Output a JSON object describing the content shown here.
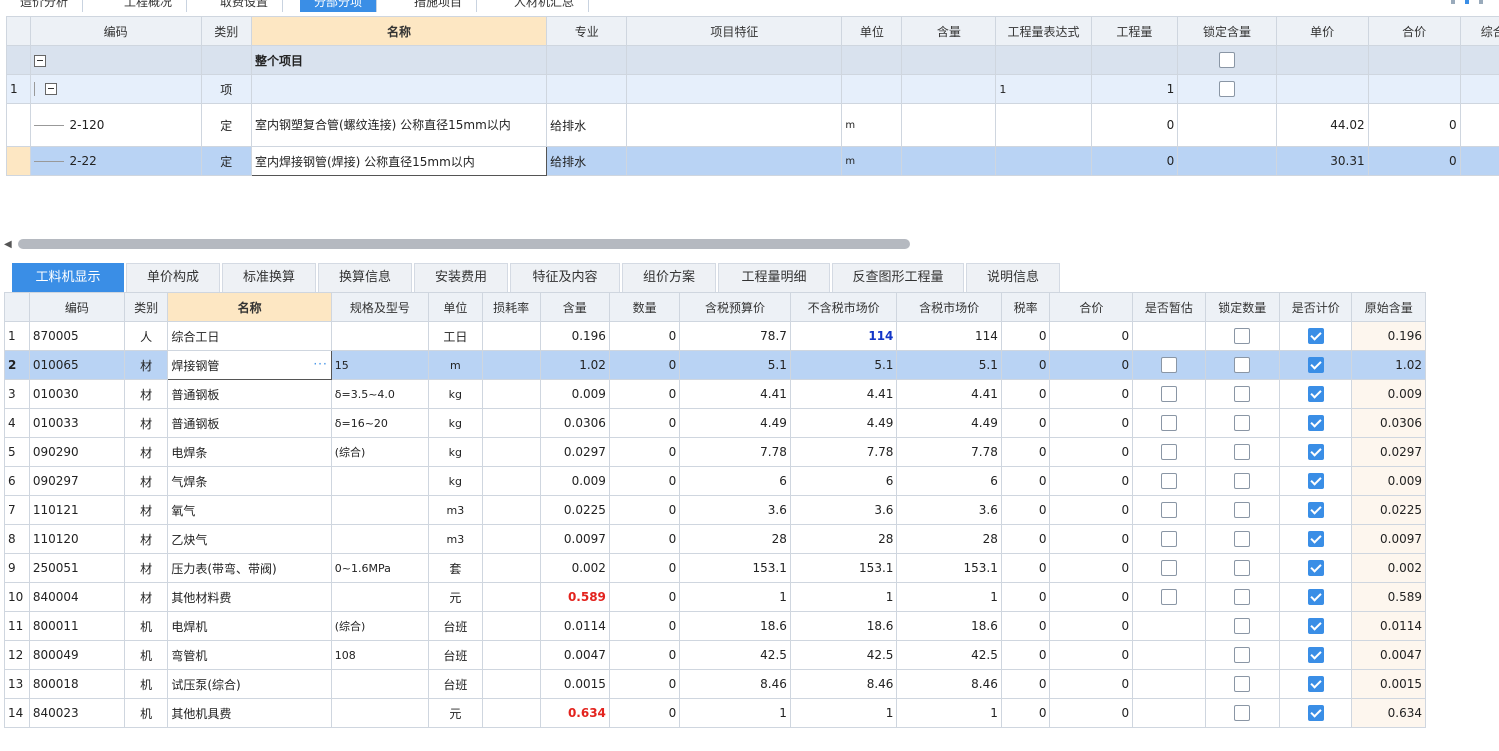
{
  "top_tabs": [
    {
      "label": "造价分析"
    },
    {
      "label": "工程概况"
    },
    {
      "label": "取费设置"
    },
    {
      "label": "分部分项",
      "active": true
    },
    {
      "label": "措施项目"
    },
    {
      "label": "人材机汇总"
    }
  ],
  "upper_table": {
    "headers": [
      "编码",
      "类别",
      "名称",
      "专业",
      "项目特征",
      "单位",
      "含量",
      "工程量表达式",
      "工程量",
      "锁定含量",
      "单价",
      "合价",
      "综合"
    ],
    "rows": [
      {
        "idx": "",
        "code": "",
        "type": "",
        "name": "整个项目",
        "major": "",
        "feature": "",
        "unit": "",
        "content": "",
        "expr": "",
        "qty": "",
        "lock": false,
        "price": "",
        "total": ""
      },
      {
        "idx": "1",
        "code": "",
        "type": "项",
        "name": "",
        "major": "",
        "feature": "",
        "unit": "",
        "content": "",
        "expr": "1",
        "qty": "1",
        "lock": false,
        "price": "",
        "total": ""
      },
      {
        "idx": "",
        "code": "2-120",
        "type": "定",
        "name": "室内钢塑复合管(螺纹连接) 公称直径15mm以内",
        "major": "给排水",
        "feature": "",
        "unit": "m",
        "content": "",
        "expr": "",
        "qty": "0",
        "price": "44.02",
        "total": "0"
      },
      {
        "idx": "",
        "code": "2-22",
        "type": "定",
        "name": "室内焊接钢管(焊接) 公称直径15mm以内",
        "major": "给排水",
        "feature": "",
        "unit": "m",
        "content": "",
        "expr": "",
        "qty": "0",
        "price": "30.31",
        "total": "0"
      }
    ]
  },
  "lower_tabs": [
    {
      "label": "工料机显示",
      "active": true
    },
    {
      "label": "单价构成"
    },
    {
      "label": "标准换算"
    },
    {
      "label": "换算信息"
    },
    {
      "label": "安装费用"
    },
    {
      "label": "特征及内容"
    },
    {
      "label": "组价方案"
    },
    {
      "label": "工程量明细"
    },
    {
      "label": "反查图形工程量"
    },
    {
      "label": "说明信息"
    }
  ],
  "lower_table": {
    "headers": [
      "编码",
      "类别",
      "名称",
      "规格及型号",
      "单位",
      "损耗率",
      "含量",
      "数量",
      "含税预算价",
      "不含税市场价",
      "含税市场价",
      "税率",
      "合价",
      "是否暂估",
      "锁定数量",
      "是否计价",
      "原始含量"
    ],
    "rows": [
      {
        "idx": "1",
        "code": "870005",
        "type": "人",
        "name": "综合工日",
        "spec": "",
        "unit": "工日",
        "loss": "",
        "content": "0.196",
        "qty": "0",
        "budget": "78.7",
        "mkt_ex": "114",
        "mkt_in": "114",
        "tax": "0",
        "total": "0",
        "est": null,
        "lockq": false,
        "priced": true,
        "orig": "0.196"
      },
      {
        "idx": "2",
        "code": "010065",
        "type": "材",
        "name": "焊接钢管",
        "spec": "15",
        "unit": "m",
        "loss": "",
        "content": "1.02",
        "qty": "0",
        "budget": "5.1",
        "mkt_ex": "5.1",
        "mkt_in": "5.1",
        "tax": "0",
        "total": "0",
        "est": false,
        "lockq": false,
        "priced": true,
        "orig": "1.02"
      },
      {
        "idx": "3",
        "code": "010030",
        "type": "材",
        "name": "普通钢板",
        "spec": "δ=3.5~4.0",
        "unit": "kg",
        "loss": "",
        "content": "0.009",
        "qty": "0",
        "budget": "4.41",
        "mkt_ex": "4.41",
        "mkt_in": "4.41",
        "tax": "0",
        "total": "0",
        "est": false,
        "lockq": false,
        "priced": true,
        "orig": "0.009"
      },
      {
        "idx": "4",
        "code": "010033",
        "type": "材",
        "name": "普通钢板",
        "spec": "δ=16~20",
        "unit": "kg",
        "loss": "",
        "content": "0.0306",
        "qty": "0",
        "budget": "4.49",
        "mkt_ex": "4.49",
        "mkt_in": "4.49",
        "tax": "0",
        "total": "0",
        "est": false,
        "lockq": false,
        "priced": true,
        "orig": "0.0306"
      },
      {
        "idx": "5",
        "code": "090290",
        "type": "材",
        "name": "电焊条",
        "spec": "(综合)",
        "unit": "kg",
        "loss": "",
        "content": "0.0297",
        "qty": "0",
        "budget": "7.78",
        "mkt_ex": "7.78",
        "mkt_in": "7.78",
        "tax": "0",
        "total": "0",
        "est": false,
        "lockq": false,
        "priced": true,
        "orig": "0.0297"
      },
      {
        "idx": "6",
        "code": "090297",
        "type": "材",
        "name": "气焊条",
        "spec": "",
        "unit": "kg",
        "loss": "",
        "content": "0.009",
        "qty": "0",
        "budget": "6",
        "mkt_ex": "6",
        "mkt_in": "6",
        "tax": "0",
        "total": "0",
        "est": false,
        "lockq": false,
        "priced": true,
        "orig": "0.009"
      },
      {
        "idx": "7",
        "code": "110121",
        "type": "材",
        "name": "氧气",
        "spec": "",
        "unit": "m3",
        "loss": "",
        "content": "0.0225",
        "qty": "0",
        "budget": "3.6",
        "mkt_ex": "3.6",
        "mkt_in": "3.6",
        "tax": "0",
        "total": "0",
        "est": false,
        "lockq": false,
        "priced": true,
        "orig": "0.0225"
      },
      {
        "idx": "8",
        "code": "110120",
        "type": "材",
        "name": "乙炔气",
        "spec": "",
        "unit": "m3",
        "loss": "",
        "content": "0.0097",
        "qty": "0",
        "budget": "28",
        "mkt_ex": "28",
        "mkt_in": "28",
        "tax": "0",
        "total": "0",
        "est": false,
        "lockq": false,
        "priced": true,
        "orig": "0.0097"
      },
      {
        "idx": "9",
        "code": "250051",
        "type": "材",
        "name": "压力表(带弯、带阀)",
        "spec": "0~1.6MPa",
        "unit": "套",
        "loss": "",
        "content": "0.002",
        "qty": "0",
        "budget": "153.1",
        "mkt_ex": "153.1",
        "mkt_in": "153.1",
        "tax": "0",
        "total": "0",
        "est": false,
        "lockq": false,
        "priced": true,
        "orig": "0.002"
      },
      {
        "idx": "10",
        "code": "840004",
        "type": "材",
        "name": "其他材料费",
        "spec": "",
        "unit": "元",
        "loss": "",
        "content": "0.589",
        "content_red": true,
        "qty": "0",
        "budget": "1",
        "mkt_ex": "1",
        "mkt_in": "1",
        "tax": "0",
        "total": "0",
        "est": false,
        "lockq": false,
        "priced": true,
        "orig": "0.589"
      },
      {
        "idx": "11",
        "code": "800011",
        "type": "机",
        "name": "电焊机",
        "spec": "(综合)",
        "unit": "台班",
        "loss": "",
        "content": "0.0114",
        "qty": "0",
        "budget": "18.6",
        "mkt_ex": "18.6",
        "mkt_in": "18.6",
        "tax": "0",
        "total": "0",
        "est": null,
        "lockq": false,
        "priced": true,
        "orig": "0.0114"
      },
      {
        "idx": "12",
        "code": "800049",
        "type": "机",
        "name": "弯管机",
        "spec": "108",
        "unit": "台班",
        "loss": "",
        "content": "0.0047",
        "qty": "0",
        "budget": "42.5",
        "mkt_ex": "42.5",
        "mkt_in": "42.5",
        "tax": "0",
        "total": "0",
        "est": null,
        "lockq": false,
        "priced": true,
        "orig": "0.0047"
      },
      {
        "idx": "13",
        "code": "800018",
        "type": "机",
        "name": "试压泵(综合)",
        "spec": "",
        "unit": "台班",
        "loss": "",
        "content": "0.0015",
        "qty": "0",
        "budget": "8.46",
        "mkt_ex": "8.46",
        "mkt_in": "8.46",
        "tax": "0",
        "total": "0",
        "est": null,
        "lockq": false,
        "priced": true,
        "orig": "0.0015"
      },
      {
        "idx": "14",
        "code": "840023",
        "type": "机",
        "name": "其他机具费",
        "spec": "",
        "unit": "元",
        "loss": "",
        "content": "0.634",
        "content_red": true,
        "qty": "0",
        "budget": "1",
        "mkt_ex": "1",
        "mkt_in": "1",
        "tax": "0",
        "total": "0",
        "est": null,
        "lockq": false,
        "priced": true,
        "orig": "0.634"
      }
    ]
  },
  "colors": {
    "accent": "#3a8ee6",
    "selected_row": "#b9d3f4",
    "red_value": "#e3231e",
    "blue_value": "#1336c8"
  }
}
